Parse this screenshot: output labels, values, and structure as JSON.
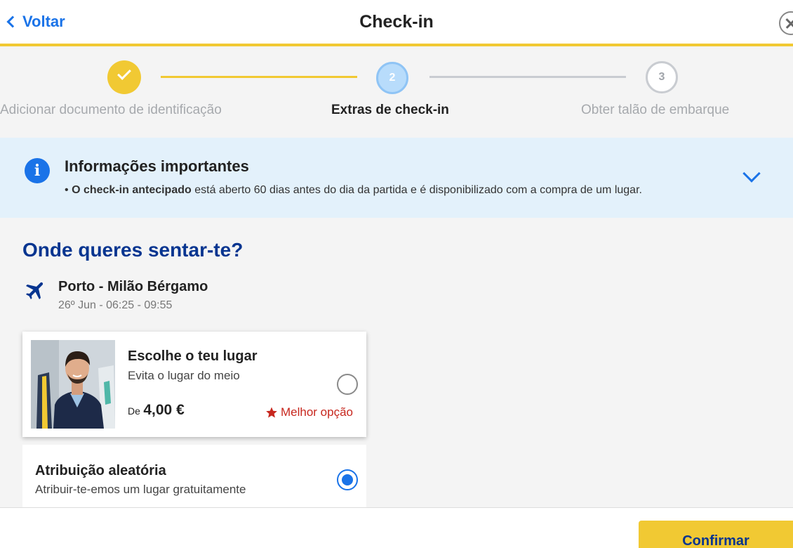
{
  "header": {
    "back_label": "Voltar",
    "title": "Check-in"
  },
  "stepper": {
    "steps": [
      {
        "number": "1",
        "label": "Adicionar documento de identificação",
        "status": "completed"
      },
      {
        "number": "2",
        "label": "Extras de check-in",
        "status": "active"
      },
      {
        "number": "3",
        "label": "Obter talão de embarque",
        "status": "pending"
      }
    ]
  },
  "info": {
    "title": "Informações importantes",
    "bullet": "•",
    "bold_text": "O check-in antecipado",
    "text": " está aberto 60 dias antes do dia da partida e é disponibilizado com a compra de um lugar."
  },
  "seat": {
    "section_title": "Onde queres sentar-te?",
    "route": "Porto - Milão Bérgamo",
    "time": "26º Jun - 06:25 - 09:55",
    "options": [
      {
        "title": "Escolhe o teu lugar",
        "subtitle": "Evita o lugar do meio",
        "price_prefix": "De",
        "price": "4,00 €",
        "badge": "Melhor opção",
        "selected": false
      },
      {
        "title": "Atribuição aleatória",
        "subtitle": "Atribuir-te-emos um lugar gratuitamente",
        "selected": true
      }
    ]
  },
  "footer": {
    "confirm_label": "Confirmar"
  },
  "colors": {
    "accent_yellow": "#f1c933",
    "brand_blue": "#073590",
    "link_blue": "#1a73e8",
    "badge_red": "#c7271e",
    "info_bg": "#e3f1fb"
  }
}
